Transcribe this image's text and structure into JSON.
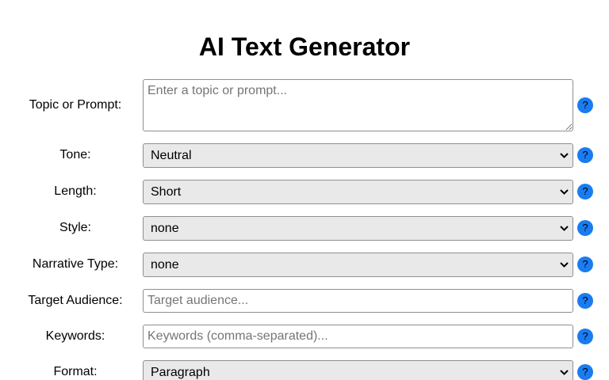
{
  "header": {
    "title": "AI Text Generator"
  },
  "form": {
    "topic": {
      "label": "Topic or Prompt:",
      "placeholder": "Enter a topic or prompt...",
      "value": ""
    },
    "tone": {
      "label": "Tone:",
      "value": "Neutral"
    },
    "length": {
      "label": "Length:",
      "value": "Short"
    },
    "style": {
      "label": "Style:",
      "value": "none"
    },
    "narrative": {
      "label": "Narrative Type:",
      "value": "none"
    },
    "audience": {
      "label": "Target Audience:",
      "placeholder": "Target audience...",
      "value": ""
    },
    "keywords": {
      "label": "Keywords:",
      "placeholder": "Keywords (comma-separated)...",
      "value": ""
    },
    "format": {
      "label": "Format:",
      "value": "Paragraph"
    },
    "help_label": "?"
  },
  "colors": {
    "help_button": "#1a7cf0",
    "select_bg": "#e9e9e9",
    "border": "#8f8f8f"
  },
  "icons": {
    "help": "question-mark-icon",
    "dropdown": "chevron-down-icon"
  }
}
